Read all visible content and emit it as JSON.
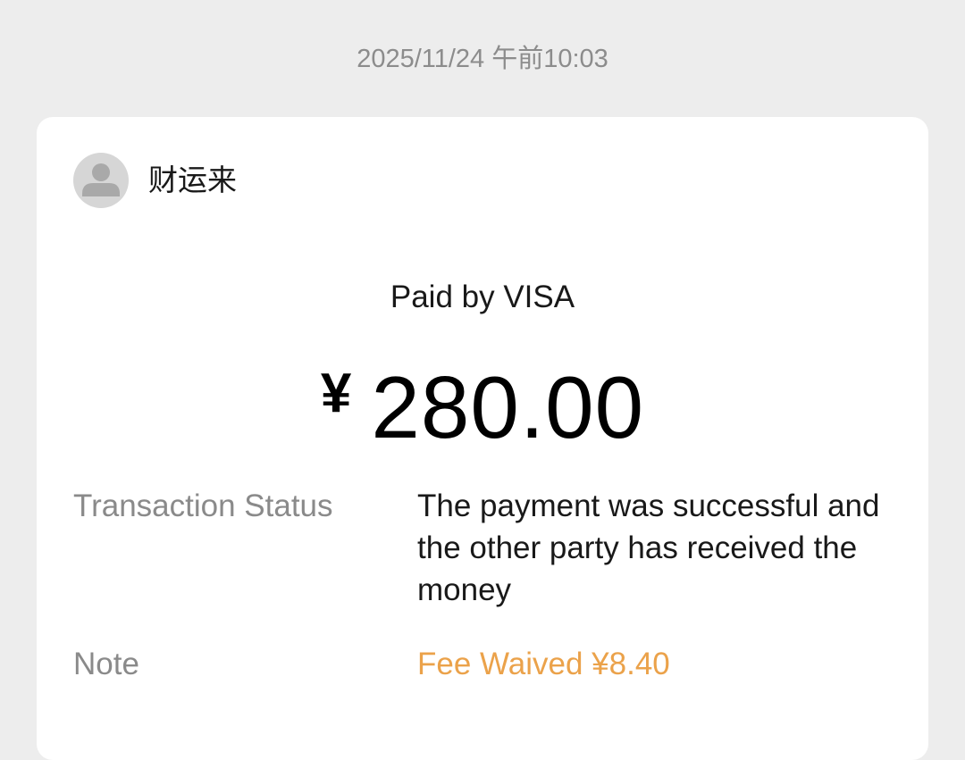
{
  "timestamp": "2025/11/24 午前10:03",
  "merchant": {
    "name": "财运来",
    "avatar_icon": "user-avatar-icon"
  },
  "payment": {
    "method_label": "Paid by VISA",
    "currency_symbol": "¥",
    "amount": "280.00"
  },
  "details": {
    "status_label": "Transaction Status",
    "status_value": "The payment was successful and the other party has received the money",
    "note_label": "Note",
    "note_value": "Fee Waived ¥8.40",
    "note_color": "#eba24a"
  }
}
